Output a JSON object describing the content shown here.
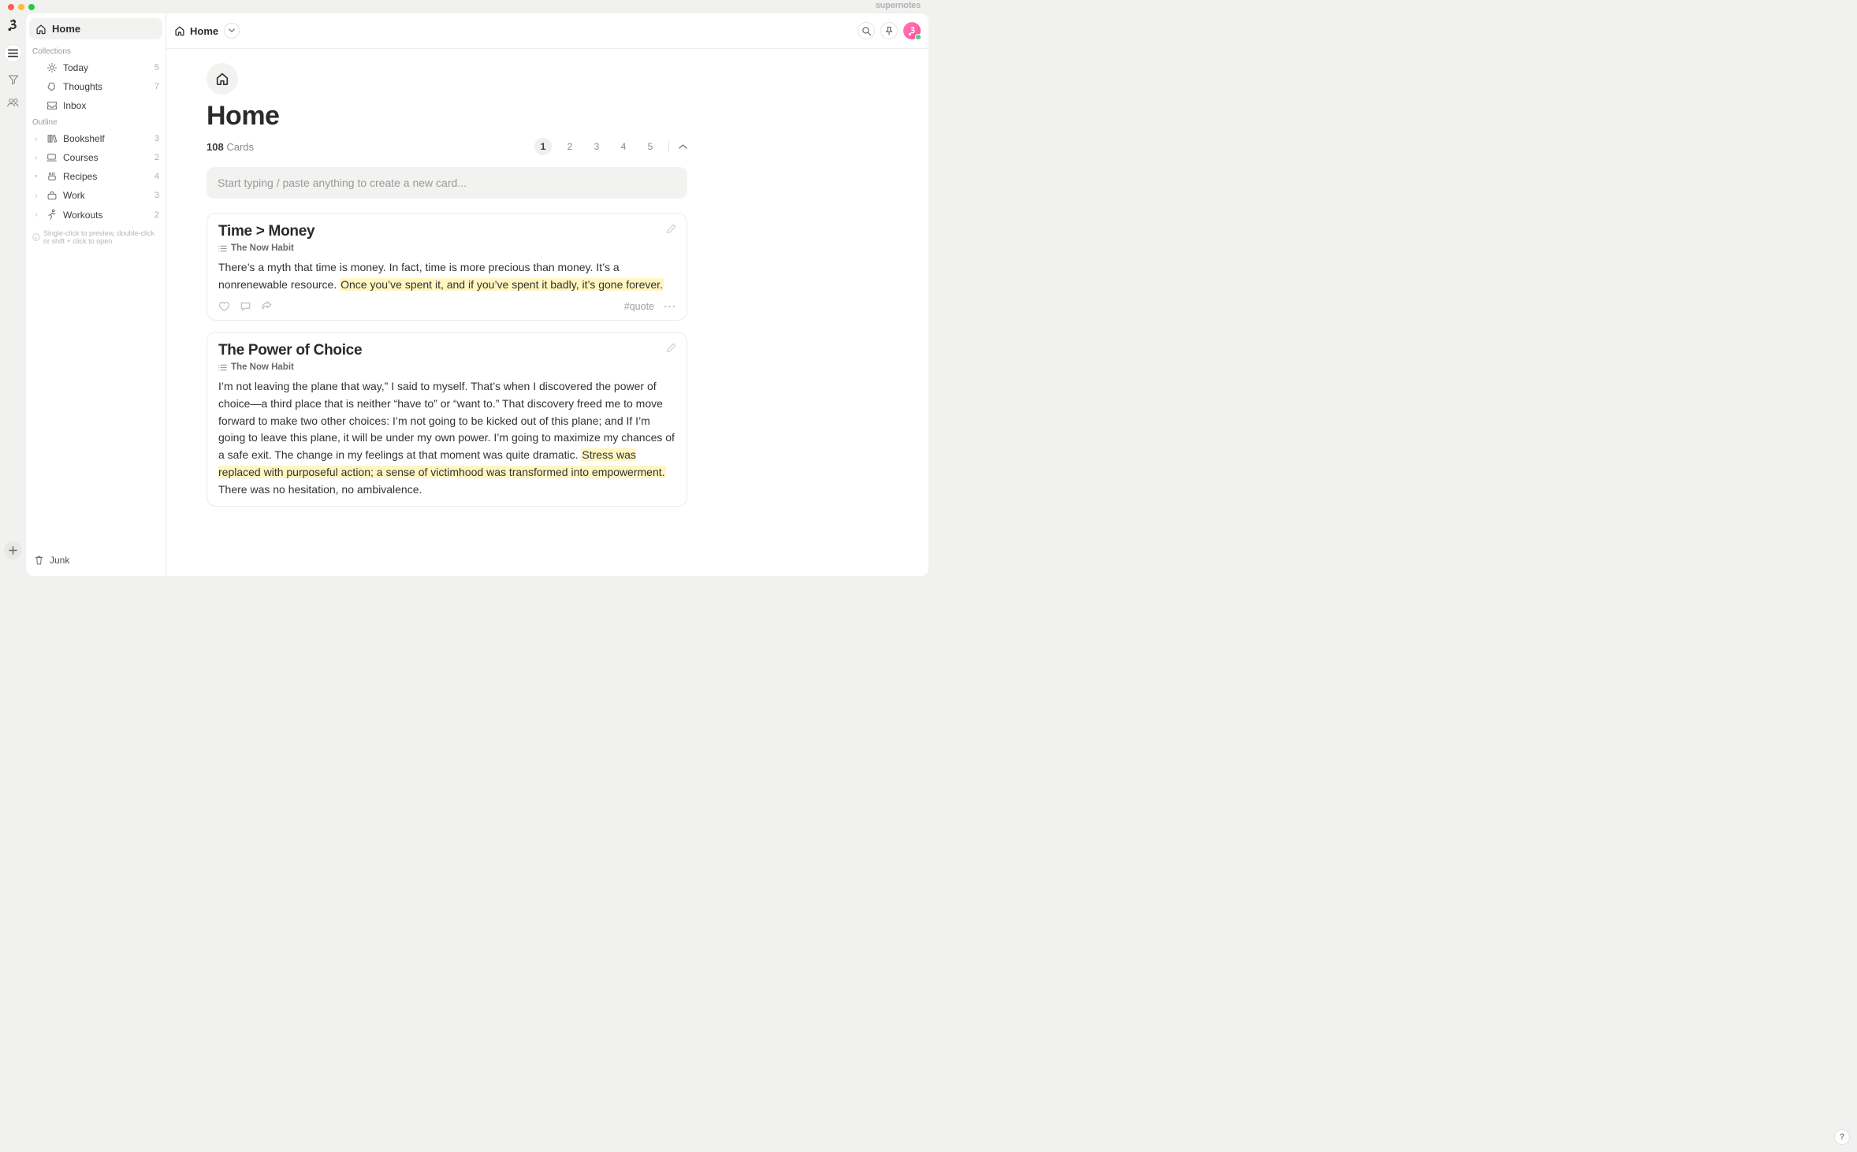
{
  "brand": "supernotes",
  "sidebar": {
    "home": "Home",
    "collections_label": "Collections",
    "collections": [
      {
        "label": "Today",
        "count": "5",
        "icon": "sun"
      },
      {
        "label": "Thoughts",
        "count": "7",
        "icon": "brain"
      },
      {
        "label": "Inbox",
        "count": "",
        "icon": "inbox"
      }
    ],
    "outline_label": "Outline",
    "outline": [
      {
        "label": "Bookshelf",
        "count": "3",
        "icon": "books",
        "expander": "chev"
      },
      {
        "label": "Courses",
        "count": "2",
        "icon": "laptop",
        "expander": "chev"
      },
      {
        "label": "Recipes",
        "count": "4",
        "icon": "recipes",
        "expander": "dot"
      },
      {
        "label": "Work",
        "count": "3",
        "icon": "briefcase",
        "expander": "chev"
      },
      {
        "label": "Workouts",
        "count": "2",
        "icon": "run",
        "expander": "chev"
      }
    ],
    "hint": "Single-click to preview, double-click or shift + click to open",
    "junk": "Junk"
  },
  "breadcrumb": {
    "home": "Home"
  },
  "page": {
    "title": "Home",
    "count_number": "108",
    "count_label": "Cards",
    "pages": [
      "1",
      "2",
      "3",
      "4",
      "5"
    ],
    "selected_page": 0,
    "new_card_placeholder": "Start typing / paste anything to create a new card..."
  },
  "cards": [
    {
      "title": "Time > Money",
      "parent": "The Now Habit",
      "body_pre": "There’s a myth that time is money. In fact, time is more precious than money. It’s a nonrenewable resource. ",
      "body_hl": "Once you’ve spent it, and if you’ve spent it badly, it’s gone forever.",
      "body_post": "",
      "tag": "#quote"
    },
    {
      "title": "The Power of Choice",
      "parent": "The Now Habit",
      "body_pre": "I’m not leaving the plane that way,” I said to myself. That’s when I discovered the power of choice—a third place that is neither “have to” or “want to.” That discovery freed me to move forward to make two other choices: I’m not going to be kicked out of this plane; and If I’m going to leave this plane, it will be under my own power. I’m going to maximize my chances of a safe exit. The change in my feelings at that moment was quite dramatic. ",
      "body_hl": "Stress was replaced with purposeful action; a sense of victimhood was transformed into empowerment.",
      "body_post": " There was no hesitation, no ambivalence.",
      "tag": ""
    }
  ]
}
